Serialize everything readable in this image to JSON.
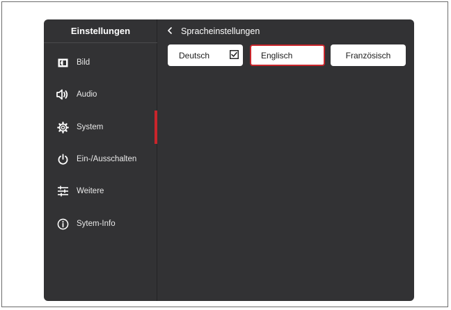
{
  "sidebar": {
    "title": "Einstellungen",
    "items": [
      {
        "label": "Bild",
        "icon": "picture-icon"
      },
      {
        "label": "Audio",
        "icon": "speaker-icon"
      },
      {
        "label": "System",
        "icon": "gear-icon"
      },
      {
        "label": "Ein-/Ausschalten",
        "icon": "power-icon"
      },
      {
        "label": "Weitere",
        "icon": "sliders-icon"
      },
      {
        "label": "Sytem-Info",
        "icon": "info-icon"
      }
    ],
    "active_item": "System"
  },
  "main": {
    "back_icon": "chevron-left-icon",
    "header": "Spracheinstellungen",
    "languages": [
      {
        "label": "Deutsch",
        "checked": true
      },
      {
        "label": "Englisch",
        "focused": true
      },
      {
        "label": "Französisch"
      }
    ]
  },
  "colors": {
    "panel_bg": "#323234",
    "accent": "#c9252b",
    "button_bg": "#ffffff"
  }
}
